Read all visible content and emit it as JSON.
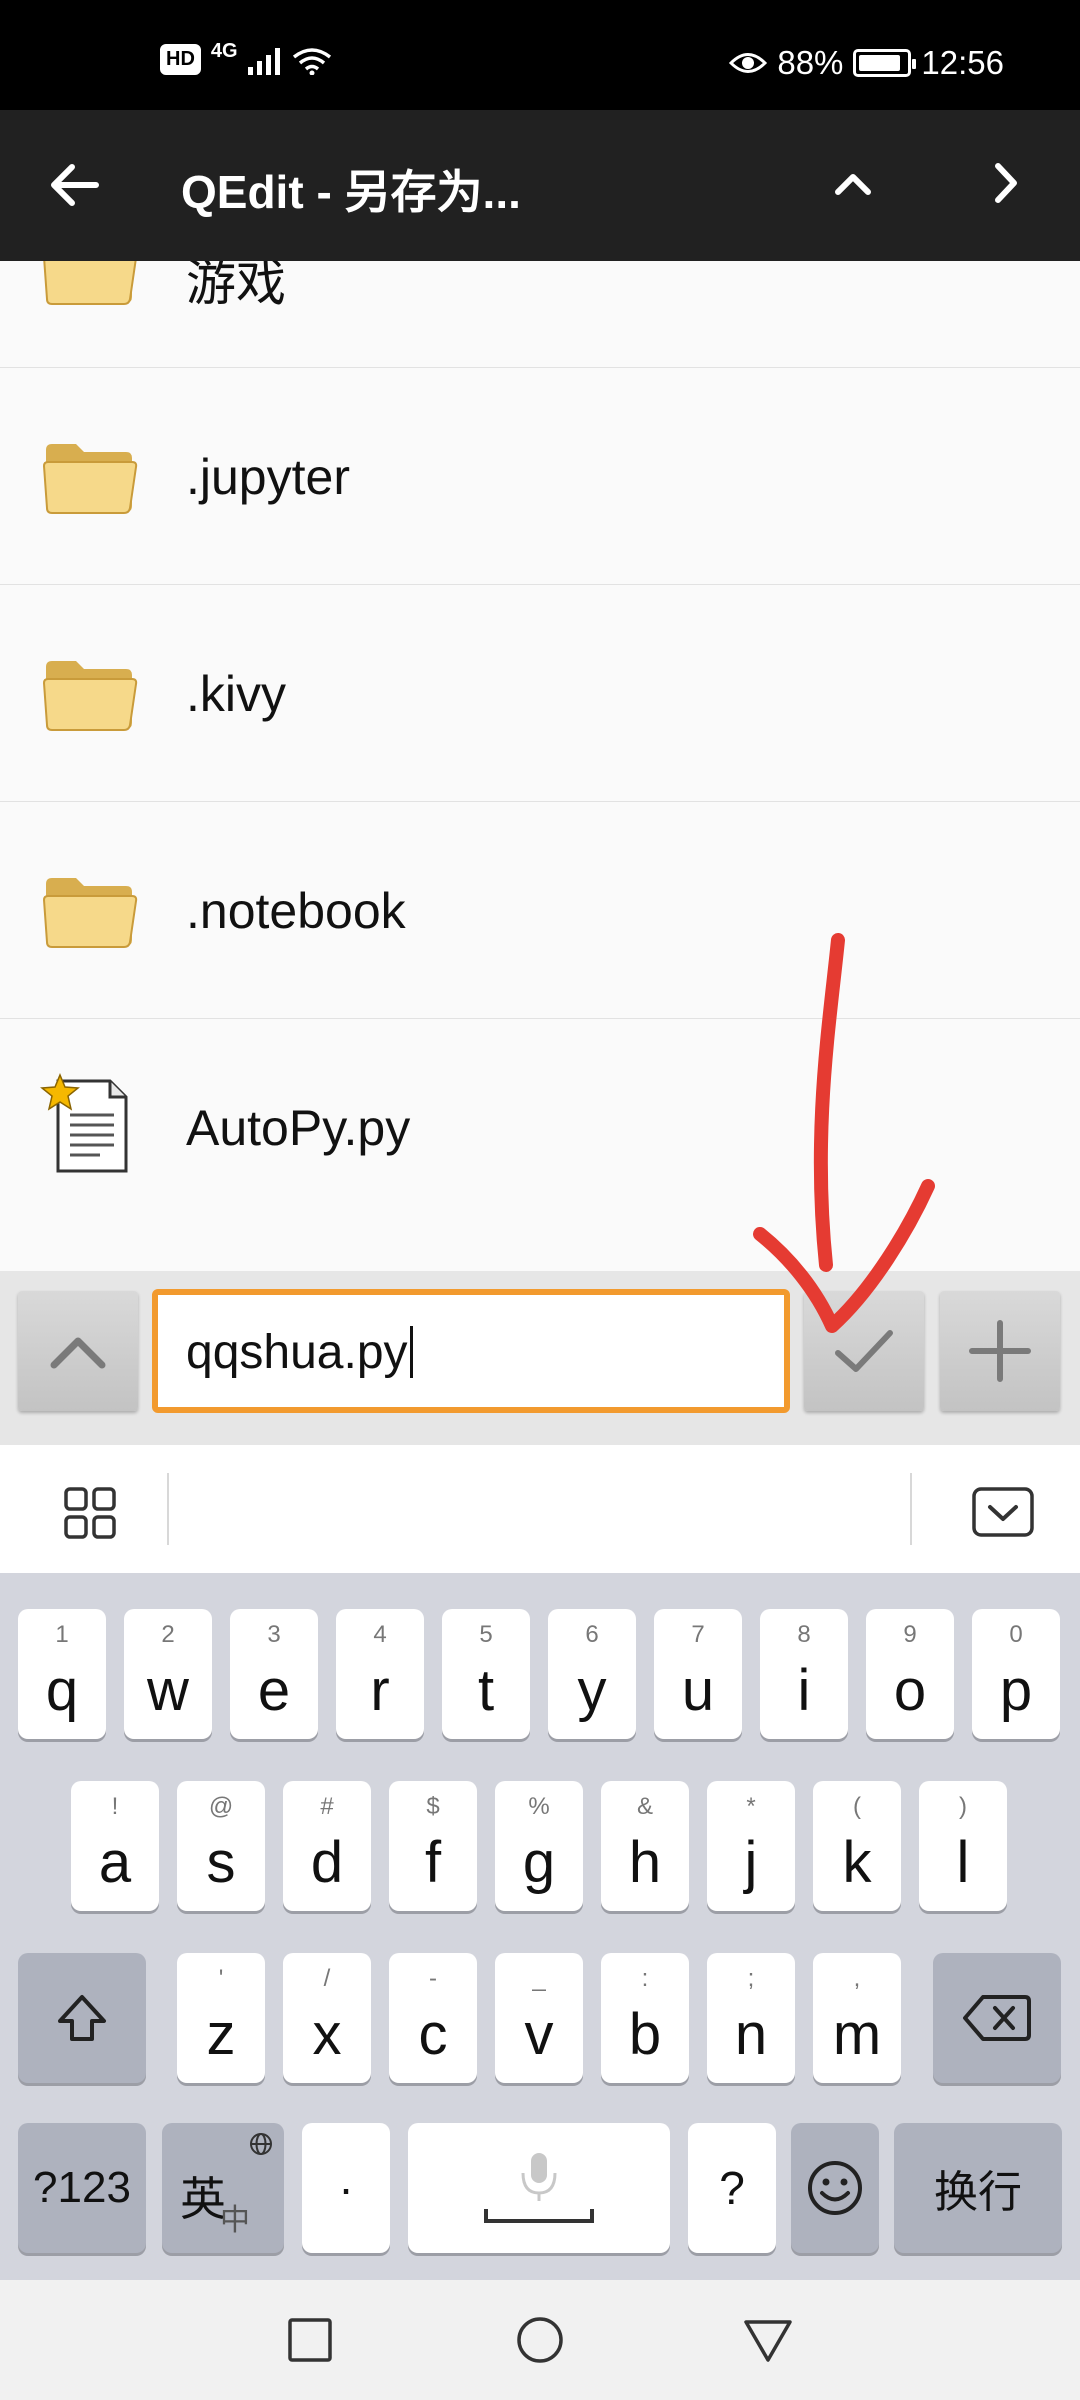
{
  "status_bar": {
    "hd": "HD",
    "network": "4G",
    "battery_percent": "88%",
    "battery_level": 0.88,
    "time": "12:56"
  },
  "toolbar": {
    "title": "QEdit - 另存为..."
  },
  "file_list": [
    {
      "name": "游戏",
      "type": "folder"
    },
    {
      "name": ".jupyter",
      "type": "folder"
    },
    {
      "name": ".kivy",
      "type": "folder"
    },
    {
      "name": ".notebook",
      "type": "folder"
    },
    {
      "name": "AutoPy.py",
      "type": "file"
    }
  ],
  "save_bar": {
    "filename": "qqshua.py"
  },
  "keyboard": {
    "row1": [
      {
        "hint": "1",
        "key": "q"
      },
      {
        "hint": "2",
        "key": "w"
      },
      {
        "hint": "3",
        "key": "e"
      },
      {
        "hint": "4",
        "key": "r"
      },
      {
        "hint": "5",
        "key": "t"
      },
      {
        "hint": "6",
        "key": "y"
      },
      {
        "hint": "7",
        "key": "u"
      },
      {
        "hint": "8",
        "key": "i"
      },
      {
        "hint": "9",
        "key": "o"
      },
      {
        "hint": "0",
        "key": "p"
      }
    ],
    "row2": [
      {
        "hint": "!",
        "key": "a"
      },
      {
        "hint": "@",
        "key": "s"
      },
      {
        "hint": "#",
        "key": "d"
      },
      {
        "hint": "$",
        "key": "f"
      },
      {
        "hint": "%",
        "key": "g"
      },
      {
        "hint": "&",
        "key": "h"
      },
      {
        "hint": "*",
        "key": "j"
      },
      {
        "hint": "(",
        "key": "k"
      },
      {
        "hint": ")",
        "key": "l"
      }
    ],
    "row3": [
      {
        "hint": "'",
        "key": "z"
      },
      {
        "hint": "/",
        "key": "x"
      },
      {
        "hint": "-",
        "key": "c"
      },
      {
        "hint": "_",
        "key": "v"
      },
      {
        "hint": ":",
        "key": "b"
      },
      {
        "hint": ";",
        "key": "n"
      },
      {
        "hint": ",",
        "key": "m"
      }
    ],
    "symbols_label": "?123",
    "lang_main": "英",
    "lang_sub": "中",
    "dot_label": "·",
    "question_label": "?",
    "enter_label": "换行"
  },
  "colors": {
    "toolbar_bg": "#212121",
    "input_border": "#f29a2e",
    "annotation": "#e53b32",
    "keyboard_bg": "#d3d5dd"
  }
}
